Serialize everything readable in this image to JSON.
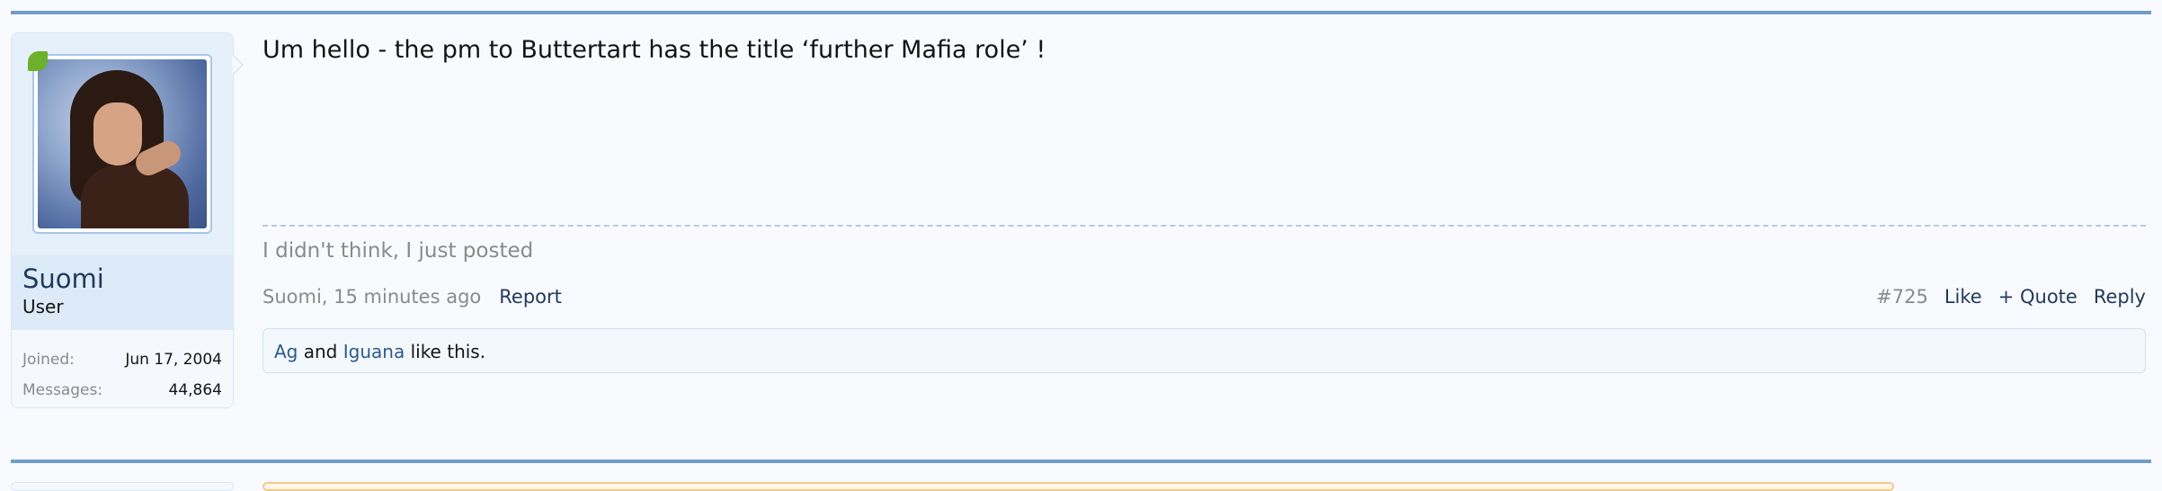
{
  "post": {
    "message": "Um hello - the pm to Buttertart has the title ‘further Mafia role’ !",
    "signature": "I didn't think, I just posted",
    "author_date": "Suomi, 15 minutes ago",
    "report_label": "Report",
    "post_number": "#725",
    "like_label": "Like",
    "quote_label": "+ Quote",
    "reply_label": "Reply"
  },
  "user": {
    "name": "Suomi",
    "title": "User",
    "stats": [
      {
        "label": "Joined:",
        "value": "Jun 17, 2004"
      },
      {
        "label": "Messages:",
        "value": "44,864"
      }
    ],
    "online_indicator_color": "#6cb02c"
  },
  "likes": {
    "liker1": "Ag",
    "conjunction": "and",
    "liker2": "Iguana",
    "suffix": "like this."
  },
  "colors": {
    "rule": "#6f9ccb",
    "link": "#1f3a5b",
    "muted": "#8a8a8a"
  }
}
